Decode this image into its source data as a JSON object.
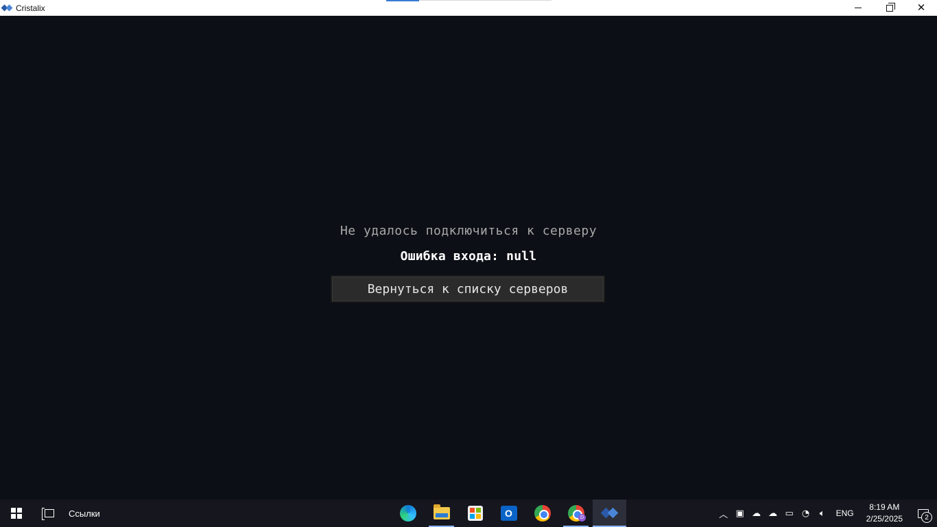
{
  "window": {
    "title": "Cristalix",
    "icon": "cristalix-logo-icon"
  },
  "game": {
    "status_title": "Не удалось подключиться к серверу",
    "error_message": "Ошибка входа: null",
    "back_button_label": "Вернуться к списку серверов"
  },
  "taskbar": {
    "links_label": "Ссылки",
    "apps": [
      {
        "name": "edge-icon"
      },
      {
        "name": "file-explorer-icon"
      },
      {
        "name": "microsoft-store-icon"
      },
      {
        "name": "outlook-icon",
        "glyph": "O"
      },
      {
        "name": "chrome-icon"
      },
      {
        "name": "chrome-profile-icon",
        "badge": "D"
      },
      {
        "name": "cristalix-icon"
      }
    ],
    "tray": {
      "language": "ENG",
      "time": "8:19 AM",
      "date": "2/25/2025",
      "notification_count": "2"
    }
  },
  "colors": {
    "game_background": "#0d0f16",
    "button_background": "#2b2b2b",
    "title_text": "#a8a8a8",
    "error_text": "#ffffff",
    "taskbar": "#16161e",
    "accent": "#8ab4f8"
  }
}
